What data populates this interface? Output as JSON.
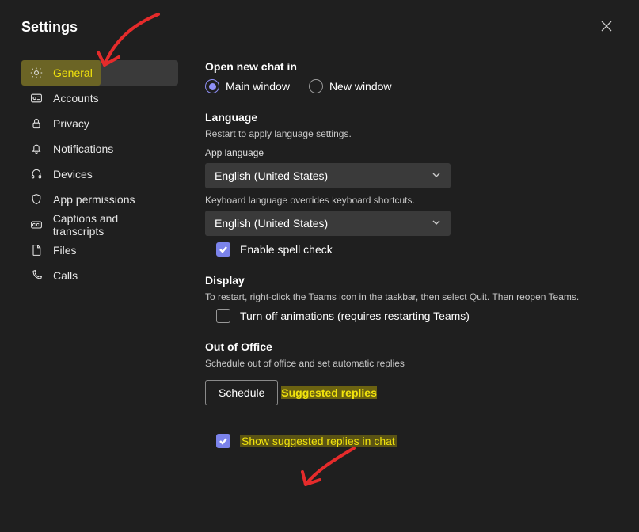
{
  "header": {
    "title": "Settings"
  },
  "sidebar": {
    "items": [
      {
        "label": "General",
        "icon": "gear-icon"
      },
      {
        "label": "Accounts",
        "icon": "badge-icon"
      },
      {
        "label": "Privacy",
        "icon": "lock-icon"
      },
      {
        "label": "Notifications",
        "icon": "bell-icon"
      },
      {
        "label": "Devices",
        "icon": "headset-icon"
      },
      {
        "label": "App permissions",
        "icon": "shield-icon"
      },
      {
        "label": "Captions and transcripts",
        "icon": "cc-icon"
      },
      {
        "label": "Files",
        "icon": "file-icon"
      },
      {
        "label": "Calls",
        "icon": "phone-icon"
      }
    ]
  },
  "open_chat": {
    "title": "Open new chat in",
    "option_main": "Main window",
    "option_new": "New window"
  },
  "language": {
    "title": "Language",
    "hint": "Restart to apply language settings.",
    "app_label": "App language",
    "app_value": "English (United States)",
    "keyboard_hint": "Keyboard language overrides keyboard shortcuts.",
    "keyboard_value": "English (United States)",
    "spellcheck_label": "Enable spell check"
  },
  "display": {
    "title": "Display",
    "hint": "To restart, right-click the Teams icon in the taskbar, then select Quit. Then reopen Teams.",
    "turn_off_label": "Turn off animations (requires restarting Teams)"
  },
  "ooo": {
    "title": "Out of Office",
    "hint": "Schedule out of office and set automatic replies",
    "button": "Schedule"
  },
  "suggested": {
    "title": "Suggested replies",
    "check_label": "Show suggested replies in chat"
  }
}
